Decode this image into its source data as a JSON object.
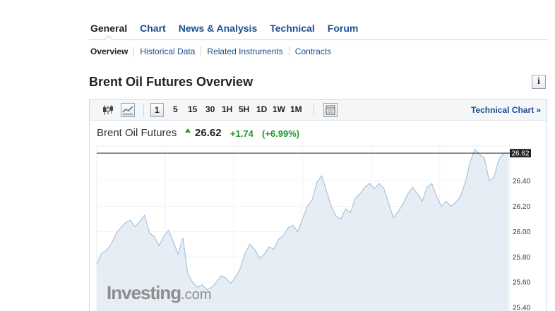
{
  "tabs": [
    {
      "label": "General",
      "active": true
    },
    {
      "label": "Chart"
    },
    {
      "label": "News & Analysis"
    },
    {
      "label": "Technical"
    },
    {
      "label": "Forum"
    }
  ],
  "subnav": [
    "Overview",
    "Historical Data",
    "Related Instruments",
    "Contracts"
  ],
  "page_title": "Brent Oil Futures Overview",
  "toolbar": {
    "timeframes": [
      "1",
      "5",
      "15",
      "30",
      "1H",
      "5H",
      "1D",
      "1W",
      "1M"
    ],
    "active_timeframe": "1",
    "technical_chart_label": "Technical Chart »"
  },
  "quote": {
    "name": "Brent Oil Futures",
    "last": "26.62",
    "change": "+1.74",
    "change_pct": "(+6.99%)",
    "direction": "up"
  },
  "colors": {
    "link": "#1b4f8f",
    "up": "#1d9a2b",
    "area_fill": "#e6edf5",
    "line": "#a9c3dc"
  },
  "chart_data": {
    "type": "area",
    "title": "",
    "xlabel": "",
    "ylabel": "",
    "ylim": [
      25.4,
      26.7
    ],
    "y_ticks": [
      "26.62",
      "26.40",
      "26.20",
      "26.00",
      "25.80",
      "25.60",
      "25.40"
    ],
    "current_value": 26.62,
    "values": [
      25.74,
      25.83,
      25.85,
      25.9,
      25.98,
      26.03,
      26.07,
      26.09,
      26.04,
      26.08,
      26.13,
      25.99,
      25.96,
      25.89,
      25.96,
      26.01,
      25.92,
      25.82,
      25.95,
      25.67,
      25.6,
      25.56,
      25.58,
      25.54,
      25.56,
      25.6,
      25.65,
      25.63,
      25.59,
      25.64,
      25.71,
      25.83,
      25.9,
      25.86,
      25.79,
      25.82,
      25.88,
      25.86,
      25.94,
      25.97,
      26.03,
      26.05,
      26.0,
      26.1,
      26.2,
      26.25,
      26.39,
      26.44,
      26.32,
      26.2,
      26.12,
      26.1,
      26.18,
      26.15,
      26.26,
      26.3,
      26.35,
      26.38,
      26.34,
      26.38,
      26.34,
      26.22,
      26.11,
      26.16,
      26.22,
      26.3,
      26.35,
      26.3,
      26.24,
      26.35,
      26.38,
      26.28,
      26.2,
      26.24,
      26.2,
      26.23,
      26.28,
      26.39,
      26.55,
      26.65,
      26.61,
      26.58,
      26.4,
      26.43,
      26.57,
      26.62,
      26.62
    ]
  },
  "logo": {
    "brand": "Investing",
    "suffix": ".com"
  }
}
